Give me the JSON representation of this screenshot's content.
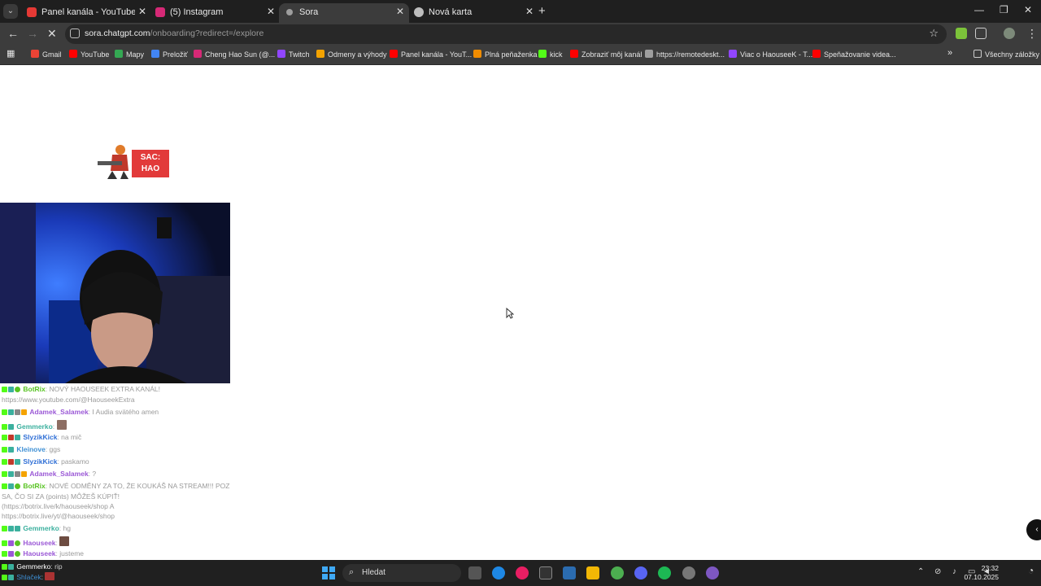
{
  "browser": {
    "tabs": [
      {
        "title": "Panel kanála - YouTube Studio",
        "color": "#e53935"
      },
      {
        "title": "(5) Instagram",
        "color": "#d62976"
      },
      {
        "title": "Sora",
        "color": "#9e9e9e"
      },
      {
        "title": "Nová karta",
        "color": "#bdbdbd"
      }
    ],
    "active_tab": 2,
    "url_host": "sora.chatgpt.com",
    "url_path": "/onboarding?redirect=/explore",
    "bookmarks": [
      {
        "label": "Gmail",
        "color": "#ea4335"
      },
      {
        "label": "YouTube",
        "color": "#ff0000"
      },
      {
        "label": "Mapy",
        "color": "#34a853"
      },
      {
        "label": "Preložiť",
        "color": "#4285f4"
      },
      {
        "label": "Cheng Hao Sun (@...",
        "color": "#d62976"
      },
      {
        "label": "Twitch",
        "color": "#9146ff"
      },
      {
        "label": "Odmeny a výhody",
        "color": "#f4a300"
      },
      {
        "label": "Panel kanála - YouT...",
        "color": "#ff0000"
      },
      {
        "label": "Plná peňaženka",
        "color": "#f08c00"
      },
      {
        "label": "kick",
        "color": "#53fc18"
      },
      {
        "label": "Zobraziť môj kanál",
        "color": "#ff0000"
      },
      {
        "label": "https://remotedeskt...",
        "color": "#9e9e9e"
      },
      {
        "label": "Viac o HaouseeK - T...",
        "color": "#9146ff"
      },
      {
        "label": "Speňažovanie videa...",
        "color": "#ff0000"
      }
    ],
    "all_bookmarks": "Všechny záložky"
  },
  "stream": {
    "logo_text": "SAC: HAO",
    "chat": [
      {
        "user": "BotRix",
        "msg": ": NOVÝ HAOUSEEK EXTRA KANÁL!",
        "color": "#58c322"
      },
      {
        "user": "",
        "msg": "https://www.youtube.com/@HaouseekExtra",
        "color": "#9a9a9a"
      },
      {
        "user": "Adamek_Salamek",
        "msg": ": I Audia svätého amen",
        "color": "#9b59d6"
      },
      {
        "user": "Gemmerko",
        "msg": ":",
        "color": "#3bb09e"
      },
      {
        "user": "SlyzikKick",
        "msg": ": na mič",
        "color": "#2f6fd6"
      },
      {
        "user": "Kleinove",
        "msg": ": ggs",
        "color": "#3e8fd4"
      },
      {
        "user": "SlyzikKick",
        "msg": ": paskamo",
        "color": "#2f6fd6"
      },
      {
        "user": "Adamek_Salamek",
        "msg": ": ?",
        "color": "#9b59d6"
      },
      {
        "user": "BotRix",
        "msg": ": NOVÉ ODMĚNY ZA TO, ŽE KOUKÁŠ NA STREAM!!! POZRI",
        "color": "#58c322"
      },
      {
        "user": "",
        "msg": "SA, ČO SI ZA (points) MÔŽEŠ KÚPIŤ!",
        "color": "#9a9a9a"
      },
      {
        "user": "",
        "msg": "(https://botrix.live/k/haouseek/shop A",
        "color": "#9a9a9a"
      },
      {
        "user": "",
        "msg": "https://botrix.live/yt/@haouseek/shop",
        "color": "#9a9a9a"
      },
      {
        "user": "Gemmerko",
        "msg": ": hg",
        "color": "#3bb09e"
      },
      {
        "user": "Haouseek",
        "msg": ":",
        "color": "#9b59d6"
      },
      {
        "user": "Haouseek",
        "msg": ": justeme",
        "color": "#9b59d6"
      }
    ],
    "overlay": [
      {
        "user": "Gemmerko",
        "msg": ": rip"
      },
      {
        "user": "Shlaček",
        "msg": ":"
      }
    ]
  },
  "taskbar": {
    "search_label": "Hledat",
    "time": "23:32",
    "date": "07.10.2025"
  }
}
